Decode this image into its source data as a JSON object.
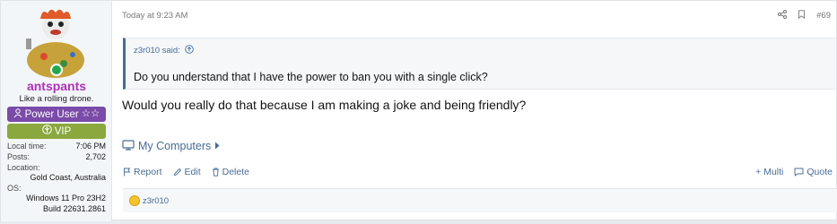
{
  "post": {
    "number": "#69",
    "date": "Today at 9:23 AM",
    "message": "Would you really do that because I am making a joke and being friendly?",
    "my_computers": "My Computers"
  },
  "user": {
    "name": "antspants",
    "title": "Like a rolling drone.",
    "banner_power": "Power User",
    "banner_vip": "VIP",
    "local_time_label": "Local time:",
    "local_time": "7:06 PM",
    "posts_label": "Posts:",
    "posts": "2,702",
    "location_label": "Location:",
    "location": "Gold Coast, Australia",
    "os_label": "OS:",
    "os_line1": "Windows 11 Pro 23H2",
    "os_line2": "Build 22631.2861"
  },
  "quote": {
    "author": "z3r010 said:",
    "text": "Do you understand that I have the power to ban you with a single click?"
  },
  "actions": {
    "report": "Report",
    "edit": "Edit",
    "delete": "Delete",
    "multi": "Multi",
    "quote": "Quote"
  },
  "reactions": {
    "user": "z3r010"
  },
  "icons": {
    "share": "share-icon",
    "bookmark": "bookmark-icon",
    "computer": "computer-icon",
    "report": "flag-icon",
    "edit": "pencil-icon",
    "delete": "trash-icon",
    "multi": "plus-icon",
    "quote": "quote-icon"
  },
  "colors": {
    "username": "#b02fb8",
    "power_banner": "#7a4ba8",
    "vip_banner": "#8aa83e",
    "link": "#476c96"
  }
}
